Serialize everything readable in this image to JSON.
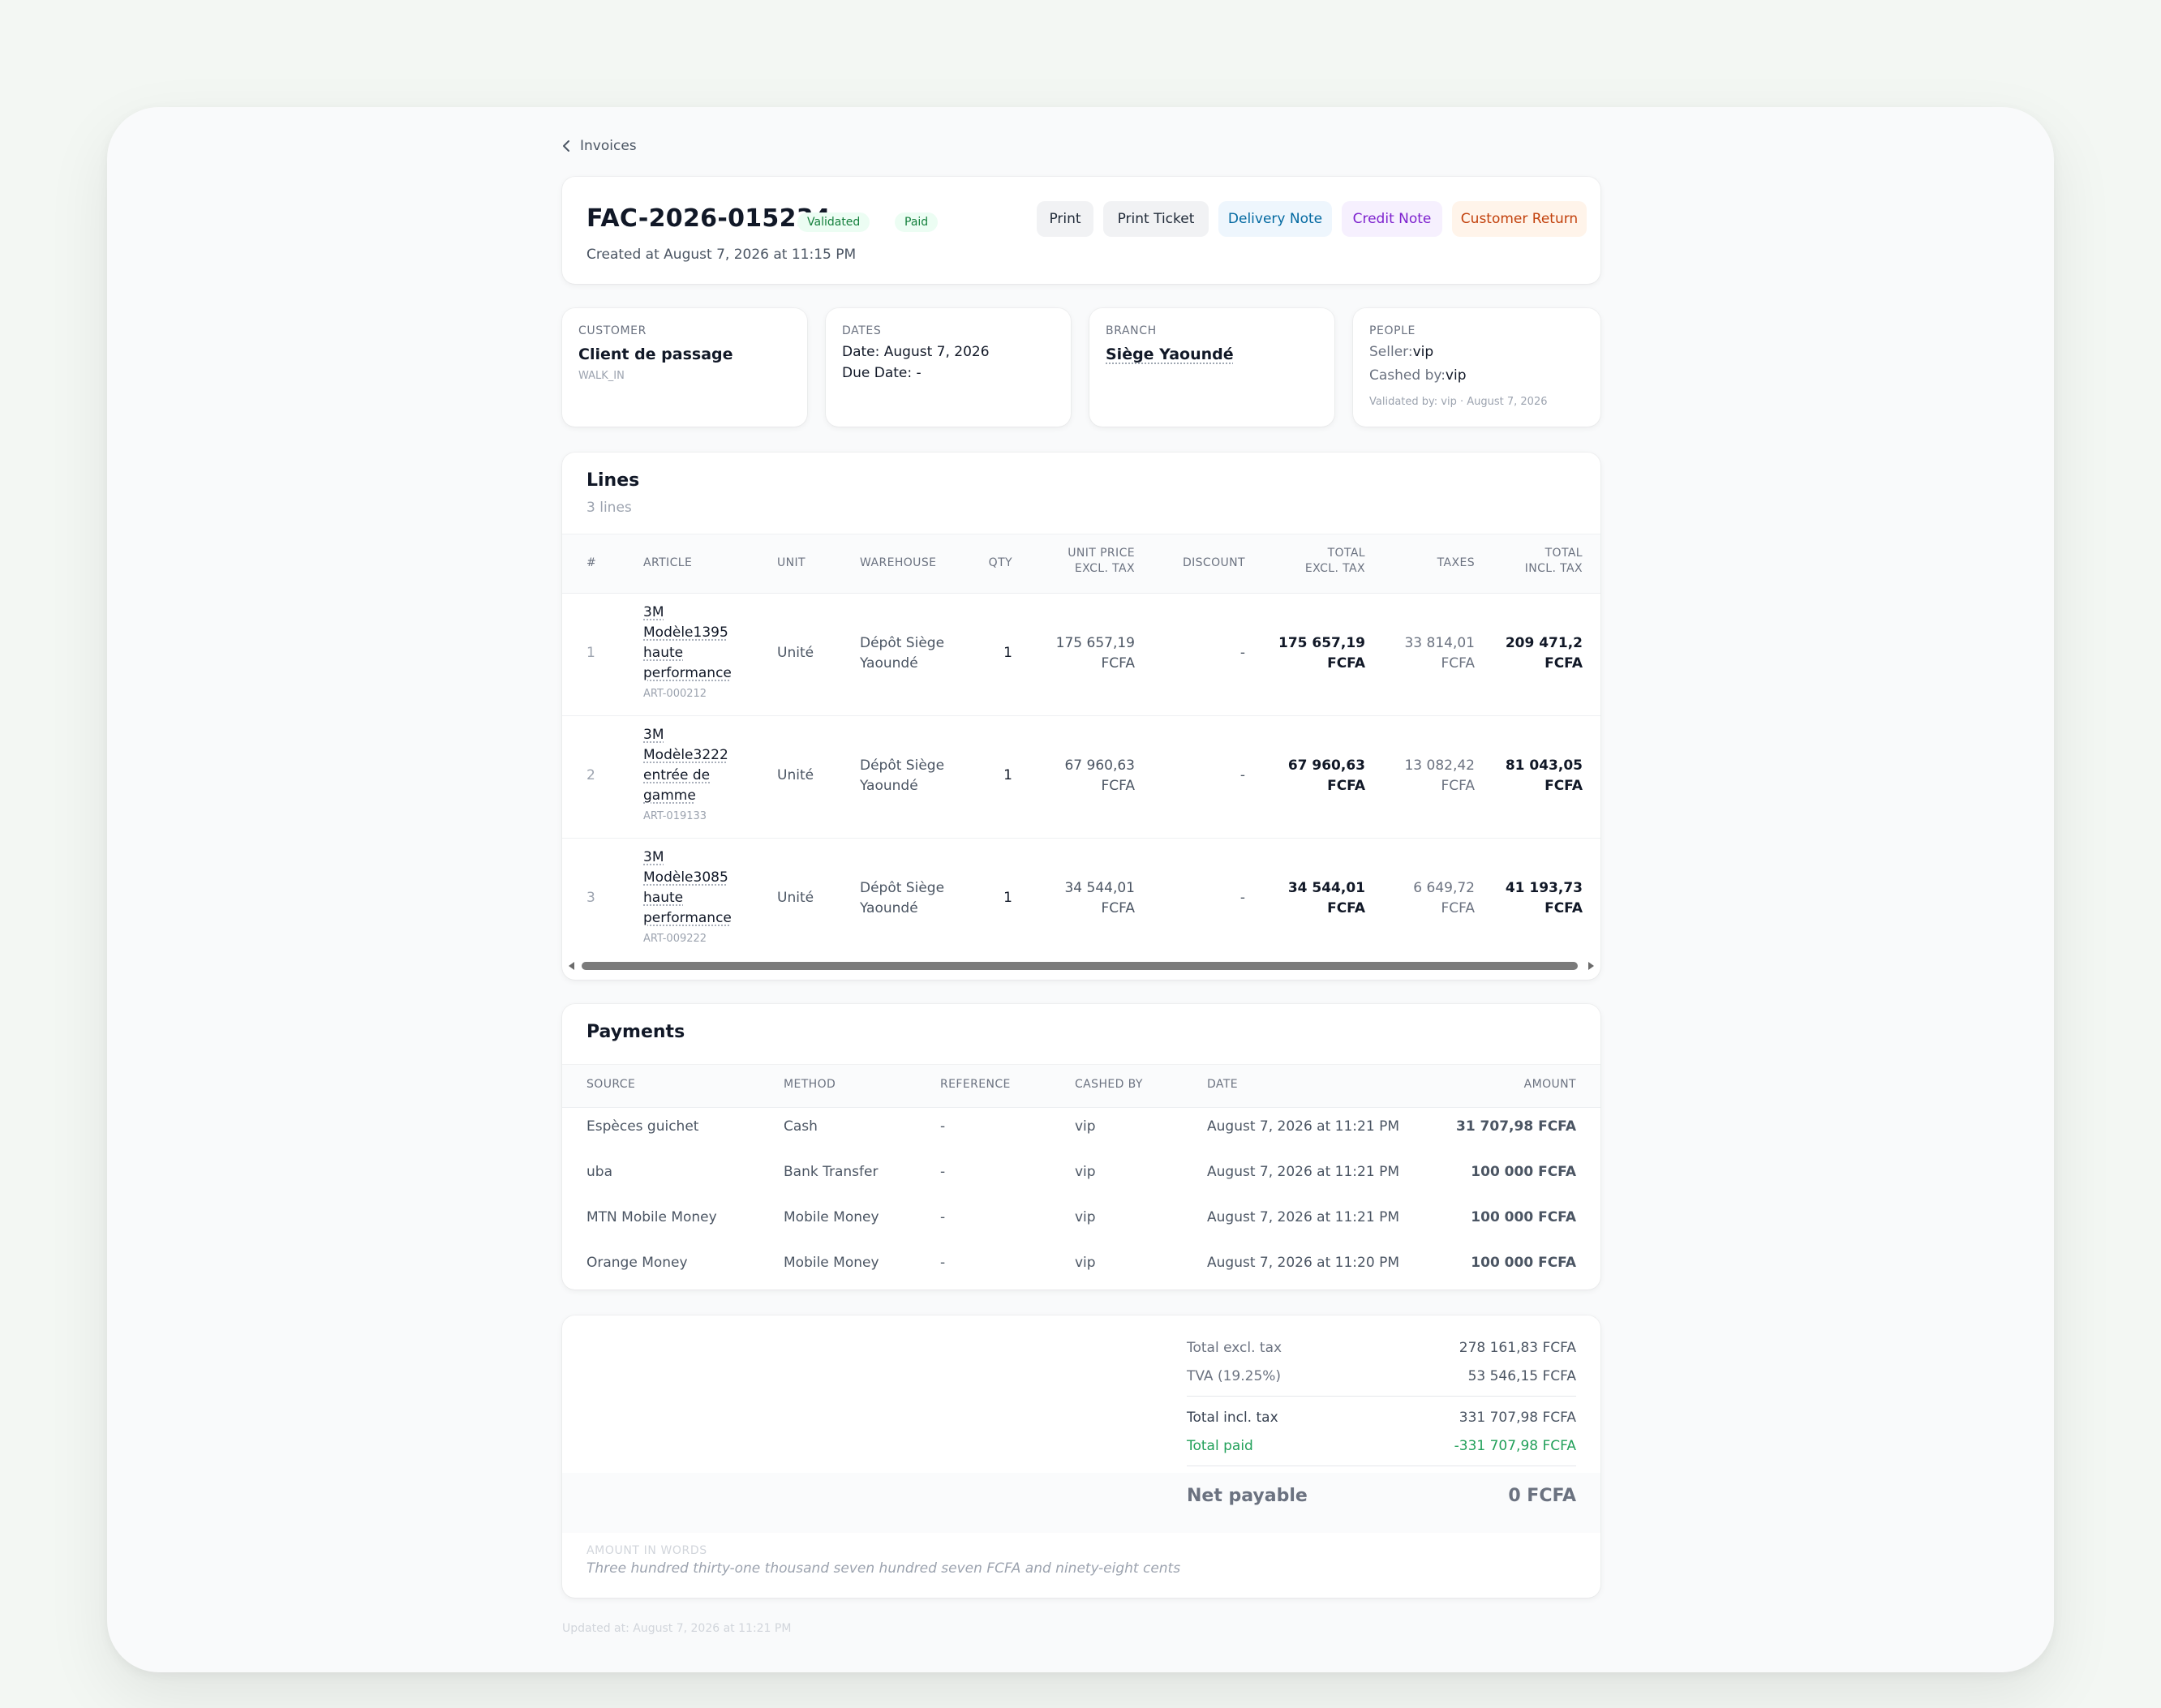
{
  "breadcrumb": {
    "label": "Invoices"
  },
  "header": {
    "invoice_number": "FAC-2026-015234",
    "badges": [
      "Validated",
      "Paid"
    ],
    "created": "Created at August 7, 2026 at 11:15 PM",
    "actions": [
      "Print",
      "Print Ticket",
      "Delivery Note",
      "Credit Note",
      "Customer Return"
    ]
  },
  "customer": {
    "label": "CUSTOMER",
    "name": "Client de passage",
    "code": "WALK_IN"
  },
  "dates": {
    "label": "DATES",
    "date_label": "Date:",
    "date": "August 7, 2026",
    "due_label": "Due Date:",
    "due": "-"
  },
  "branch": {
    "label": "BRANCH",
    "name": "Siège Yaoundé"
  },
  "people": {
    "label": "PEOPLE",
    "seller_label": "Seller:",
    "seller": "vip",
    "cashed_label": "Cashed by:",
    "cashed": "vip",
    "validated": "Validated by: vip · August 7, 2026"
  },
  "lines": {
    "title": "Lines",
    "subtitle": "3 lines",
    "headers": {
      "num": "#",
      "article": "ARTICLE",
      "unit": "UNIT",
      "warehouse": "WAREHOUSE",
      "qty": "QTY",
      "unit_price_1": "UNIT PRICE",
      "unit_price_2": "EXCL. TAX",
      "discount": "DISCOUNT",
      "total_excl_1": "TOTAL",
      "total_excl_2": "EXCL. TAX",
      "taxes": "TAXES",
      "total_incl_1": "TOTAL",
      "total_incl_2": "INCL. TAX"
    },
    "rows": [
      {
        "num": "1",
        "name": [
          "3M",
          "Modèle1395",
          "haute",
          "performance"
        ],
        "code": "ART-000212",
        "unit": "Unité",
        "warehouse": [
          "Dépôt Siège",
          "Yaoundé"
        ],
        "qty": "1",
        "unit_price": [
          "175 657,19",
          "FCFA"
        ],
        "discount": "-",
        "total_excl": [
          "175 657,19",
          "FCFA"
        ],
        "taxes": [
          "33 814,01",
          "FCFA"
        ],
        "total_incl": [
          "209 471,2",
          "FCFA"
        ]
      },
      {
        "num": "2",
        "name": [
          "3M",
          "Modèle3222",
          "entrée de",
          "gamme"
        ],
        "code": "ART-019133",
        "unit": "Unité",
        "warehouse": [
          "Dépôt Siège",
          "Yaoundé"
        ],
        "qty": "1",
        "unit_price": [
          "67 960,63",
          "FCFA"
        ],
        "discount": "-",
        "total_excl": [
          "67 960,63",
          "FCFA"
        ],
        "taxes": [
          "13 082,42",
          "FCFA"
        ],
        "total_incl": [
          "81 043,05",
          "FCFA"
        ]
      },
      {
        "num": "3",
        "name": [
          "3M",
          "Modèle3085",
          "haute",
          "performance"
        ],
        "code": "ART-009222",
        "unit": "Unité",
        "warehouse": [
          "Dépôt Siège",
          "Yaoundé"
        ],
        "qty": "1",
        "unit_price": [
          "34 544,01",
          "FCFA"
        ],
        "discount": "-",
        "total_excl": [
          "34 544,01",
          "FCFA"
        ],
        "taxes": [
          "6 649,72",
          "FCFA"
        ],
        "total_incl": [
          "41 193,73",
          "FCFA"
        ]
      }
    ]
  },
  "payments": {
    "title": "Payments",
    "headers": {
      "source": "SOURCE",
      "method": "METHOD",
      "reference": "REFERENCE",
      "cashed_by": "CASHED BY",
      "date": "DATE",
      "amount": "AMOUNT"
    },
    "rows": [
      {
        "source": "Espèces guichet",
        "method": "Cash",
        "reference": "-",
        "cashed_by": "vip",
        "date": "August 7, 2026 at 11:21 PM",
        "amount": "31 707,98 FCFA"
      },
      {
        "source": "uba",
        "method": "Bank Transfer",
        "reference": "-",
        "cashed_by": "vip",
        "date": "August 7, 2026 at 11:21 PM",
        "amount": "100 000 FCFA"
      },
      {
        "source": "MTN Mobile Money",
        "method": "Mobile Money",
        "reference": "-",
        "cashed_by": "vip",
        "date": "August 7, 2026 at 11:21 PM",
        "amount": "100 000 FCFA"
      },
      {
        "source": "Orange Money",
        "method": "Mobile Money",
        "reference": "-",
        "cashed_by": "vip",
        "date": "August 7, 2026 at 11:20 PM",
        "amount": "100 000 FCFA"
      }
    ]
  },
  "totals": {
    "excl_label": "Total excl. tax",
    "excl": "278 161,83 FCFA",
    "tva_label": "TVA (19.25%)",
    "tva": "53 546,15 FCFA",
    "incl_label": "Total incl. tax",
    "incl": "331 707,98 FCFA",
    "paid_label": "Total paid",
    "paid": "-331 707,98 FCFA",
    "net_label": "Net payable",
    "net": "0 FCFA",
    "words_label": "AMOUNT IN WORDS",
    "words": "Three hundred thirty-one thousand seven hundred seven FCFA and ninety-eight cents"
  },
  "footer": {
    "updated": "Updated at: August 7, 2026 at 11:21 PM"
  },
  "colors": {
    "paid_green": "#22a05a",
    "badge_bg": "#ecfdf3",
    "badge_text": "#15803d"
  }
}
